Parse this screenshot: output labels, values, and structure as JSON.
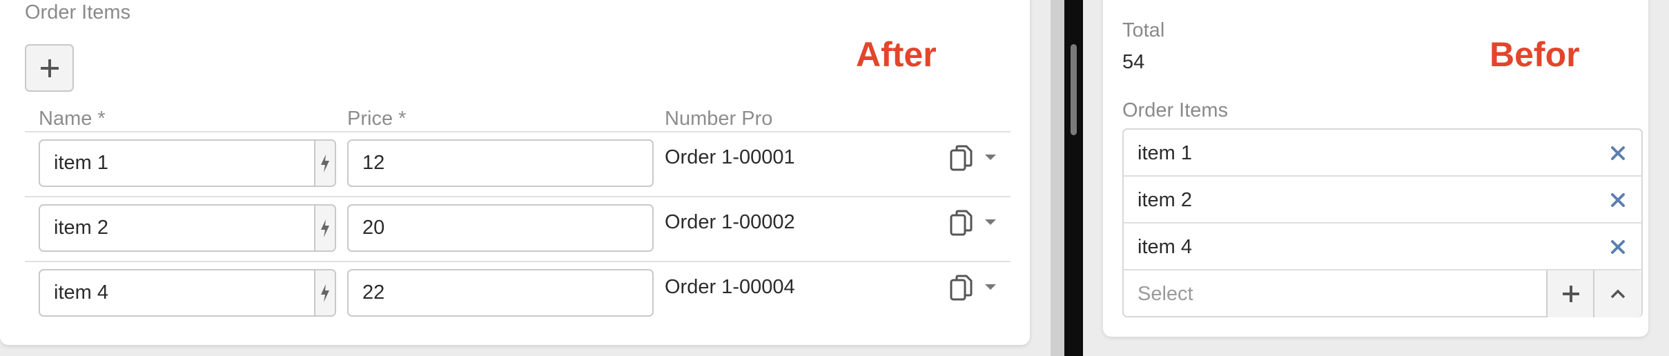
{
  "after_panel": {
    "annotation": "After",
    "section_label": "Order Items",
    "columns": {
      "name": "Name *",
      "price": "Price *",
      "number": "Number Pro"
    },
    "rows": [
      {
        "name": "item 1",
        "price": "12",
        "number": "Order 1-00001"
      },
      {
        "name": "item 2",
        "price": "20",
        "number": "Order 1-00002"
      },
      {
        "name": "item 4",
        "price": "22",
        "number": "Order 1-00004"
      }
    ]
  },
  "before_panel": {
    "annotation": "Befor",
    "total_label": "Total",
    "total_value": "54",
    "section_label": "Order Items",
    "items": [
      "item 1",
      "item 2",
      "item 4"
    ],
    "select_placeholder": "Select"
  },
  "icons": {
    "add": "plus-icon",
    "generate": "bolt-icon",
    "copy": "copy-icon",
    "menu": "caret-down-icon",
    "remove": "close-icon",
    "collapse": "chevron-up-icon"
  },
  "colors": {
    "annotation": "#e3452b",
    "remove_icon": "#5b7fb0",
    "label": "#8a8a8a"
  }
}
